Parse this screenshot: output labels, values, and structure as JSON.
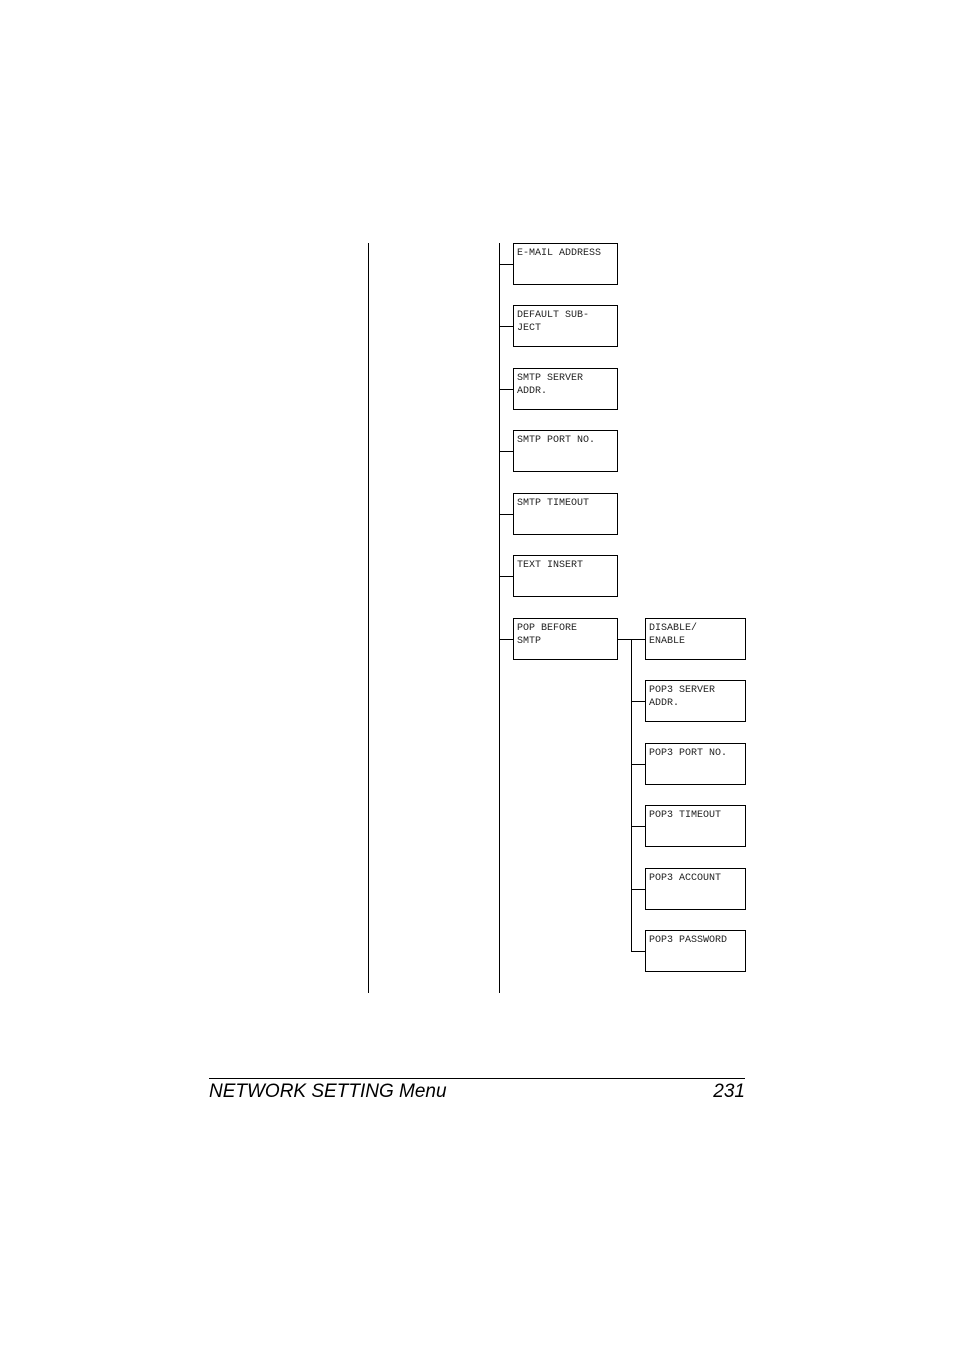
{
  "menu_tree": {
    "items": [
      {
        "label": "E-MAIL ADDRESS"
      },
      {
        "label": "DEFAULT SUB-\nJECT"
      },
      {
        "label": "SMTP SERVER\nADDR."
      },
      {
        "label": "SMTP PORT NO."
      },
      {
        "label": "SMTP TIMEOUT"
      },
      {
        "label": "TEXT INSERT"
      },
      {
        "label": "POP BEFORE\nSMTP"
      }
    ],
    "pop_before_smtp_children": [
      {
        "label": "DISABLE/\nENABLE"
      },
      {
        "label": "POP3 SERVER\nADDR."
      },
      {
        "label": "POP3 PORT NO."
      },
      {
        "label": "POP3 TIMEOUT"
      },
      {
        "label": "POP3 ACCOUNT"
      },
      {
        "label": "POP3 PASSWORD"
      }
    ]
  },
  "footer": {
    "title": "NETWORK SETTING Menu",
    "page_number": "231"
  }
}
